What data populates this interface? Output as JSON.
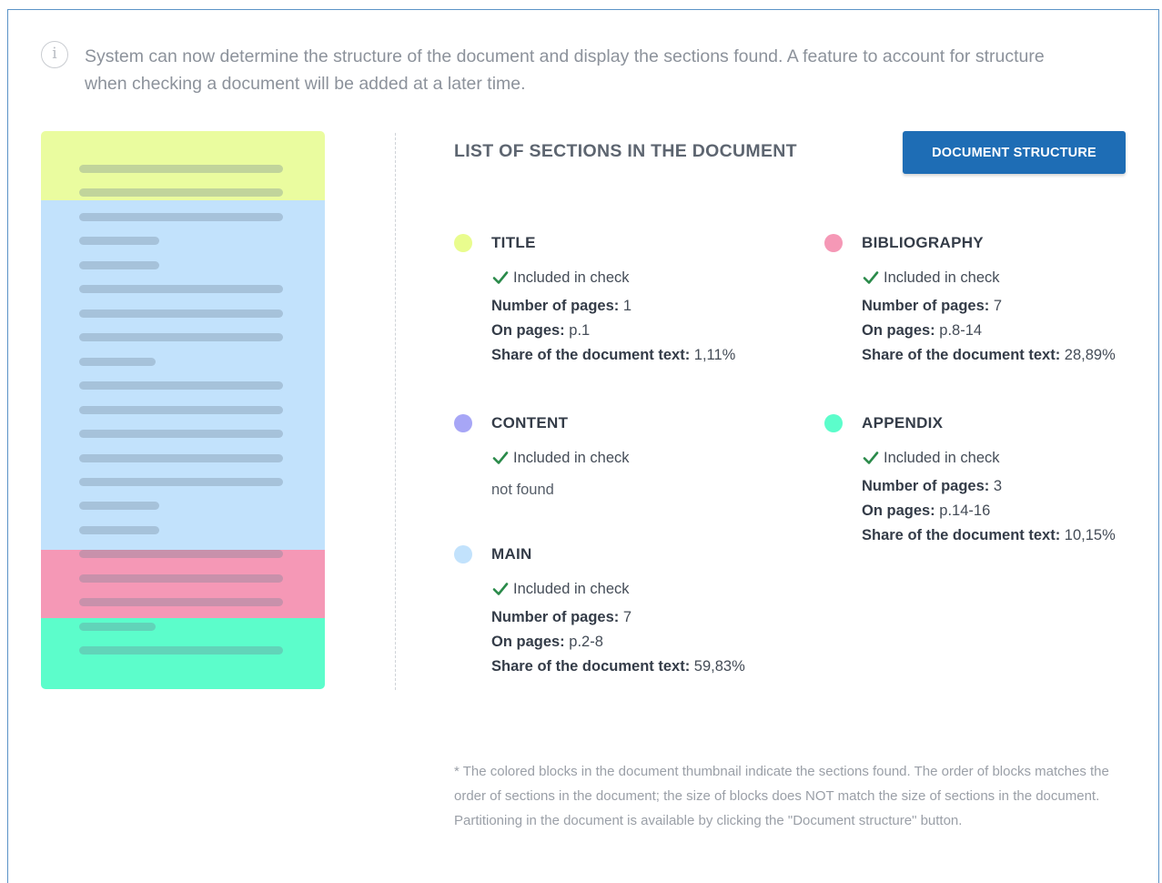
{
  "info": {
    "icon": "info-icon",
    "text": "System can now determine the structure of the document and display the sections found. A feature to account for structure when checking a document will be added at a later time."
  },
  "thumbnail": {
    "colors": {
      "title": "#eafc9f",
      "main": "#c2e2fc",
      "bibliography": "#f598b6",
      "appendix": "#5cfdcb"
    }
  },
  "list_title": "LIST OF SECTIONS IN THE DOCUMENT",
  "structure_button": "DOCUMENT STRUCTURE",
  "labels": {
    "pages": "Number of pages:",
    "on_pages": "On pages:",
    "share": "Share of the document text:"
  },
  "sections": {
    "title": {
      "name": "TITLE",
      "color": "#e9fc8e",
      "included": "Included in check",
      "pages": "1",
      "on_pages": "p.1",
      "share": "1,11%"
    },
    "content": {
      "name": "CONTENT",
      "color": "#a7a6f6",
      "included": "Included in check",
      "not_found": "not found"
    },
    "main": {
      "name": "MAIN",
      "color": "#c2e2fc",
      "included": "Included in check",
      "pages": "7",
      "on_pages": "p.2-8",
      "share": "59,83%"
    },
    "bibliography": {
      "name": "BIBLIOGRAPHY",
      "color": "#f598b6",
      "included": "Included in check",
      "pages": "7",
      "on_pages": "p.8-14",
      "share": "28,89%"
    },
    "appendix": {
      "name": "APPENDIX",
      "color": "#5cfdcb",
      "included": "Included in check",
      "pages": "3",
      "on_pages": "p.14-16",
      "share": "10,15%"
    }
  },
  "check_icon": "check-icon",
  "check_color": "#2a8a4a",
  "footnote": "* The colored blocks in the document thumbnail indicate the sections found. The order of blocks matches the order of sections in the document; the size of blocks does NOT match the size of sections in the document. Partitioning in the document is available by clicking the \"Document structure\" button."
}
